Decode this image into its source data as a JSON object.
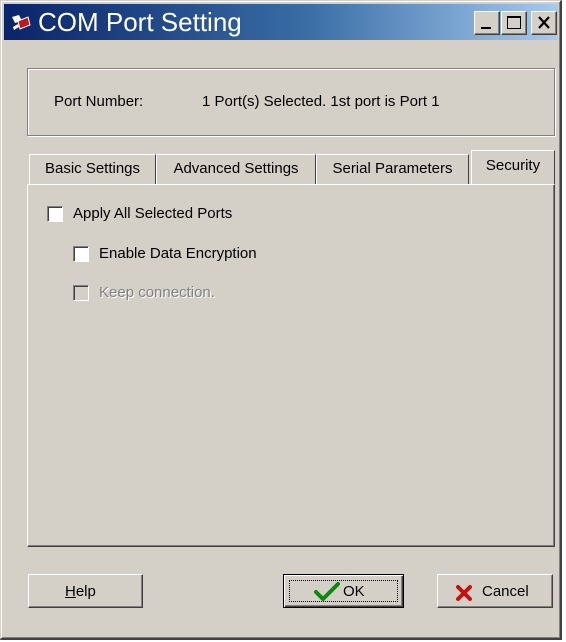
{
  "window": {
    "title": "COM Port Setting",
    "controls": {
      "minimize": "minimize-icon",
      "maximize": "maximize-icon",
      "close": "close-icon"
    }
  },
  "port": {
    "label": "Port Number:",
    "value": "1 Port(s) Selected. 1st port is Port 1"
  },
  "tabs": [
    {
      "label": "Basic Settings",
      "active": false
    },
    {
      "label": "Advanced Settings",
      "active": false
    },
    {
      "label": "Serial Parameters",
      "active": false
    },
    {
      "label": "Security",
      "active": true
    }
  ],
  "security": {
    "apply_all": {
      "label": "Apply All Selected Ports",
      "checked": false
    },
    "enable_encryption": {
      "label": "Enable Data Encryption",
      "checked": false
    },
    "keep_connection": {
      "label": "Keep connection.",
      "checked": false,
      "disabled": true
    }
  },
  "buttons": {
    "help": {
      "accel": "H",
      "rest": "elp"
    },
    "ok": {
      "label": "OK"
    },
    "cancel": {
      "label": "Cancel"
    }
  }
}
